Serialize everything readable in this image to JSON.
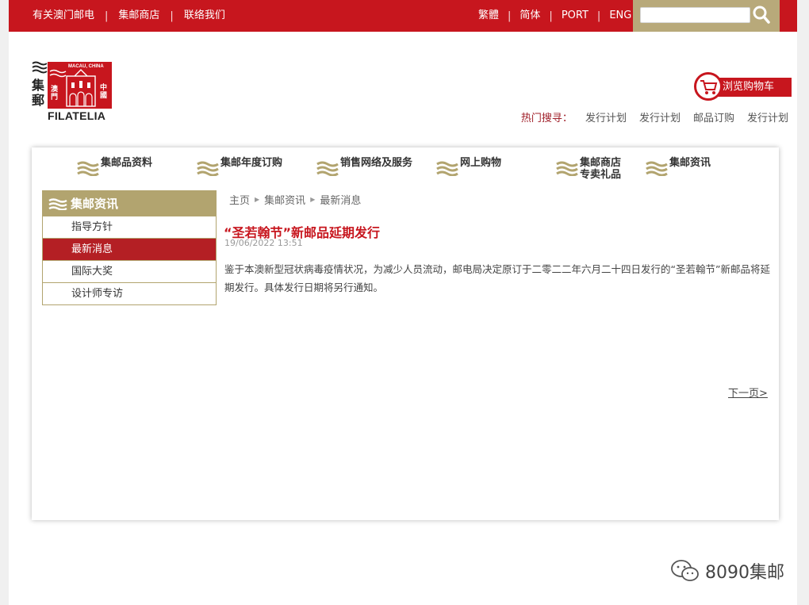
{
  "topbar": {
    "links": [
      "有关澳门邮电",
      "集邮商店",
      "联络我们"
    ],
    "langs": [
      "繁體",
      "简体",
      "PORT",
      "ENG"
    ],
    "search": {
      "value": "",
      "placeholder": ""
    }
  },
  "logo": {
    "vertical_text": [
      "集",
      "郵"
    ],
    "stamp_top": "MACAU, CHINA",
    "stamp_left": "澳門",
    "stamp_right": "中國",
    "wordmark": "FILATELIA"
  },
  "cart": {
    "label": "浏览购物车"
  },
  "hot_search": {
    "label": "热门搜寻：",
    "items": [
      "发行计划",
      "发行计划",
      "邮品订购",
      "发行计划"
    ]
  },
  "nav": {
    "items": [
      {
        "label": "集邮品资料"
      },
      {
        "label": "集邮年度订购"
      },
      {
        "label": "销售网络及服务"
      },
      {
        "label": "网上购物"
      },
      {
        "label": "集邮商店\n专卖礼品"
      },
      {
        "label": "集邮资讯"
      }
    ]
  },
  "sidebar": {
    "title": "集邮资讯",
    "items": [
      {
        "label": "指导方针",
        "active": false
      },
      {
        "label": "最新消息",
        "active": true
      },
      {
        "label": "国际大奖",
        "active": false
      },
      {
        "label": "设计师专访",
        "active": false
      }
    ]
  },
  "breadcrumb": [
    "主页",
    "集邮资讯",
    "最新消息"
  ],
  "article": {
    "title": "“圣若翰节”新邮品延期发行",
    "date": "19/06/2022 13:51",
    "body": "鉴于本澳新型冠状病毒疫情状况，为减少人员流动，邮电局决定原订于二零二二年六月二十四日发行的“圣若翰节”新邮品将延期发行。具体发行日期将另行通知。"
  },
  "pager": {
    "next_label": "下一页>"
  },
  "watermark": {
    "text": "8090集邮"
  },
  "colors": {
    "brand_red": "#c7161e",
    "gold": "#b2a46f",
    "active_red": "#b41f24"
  }
}
